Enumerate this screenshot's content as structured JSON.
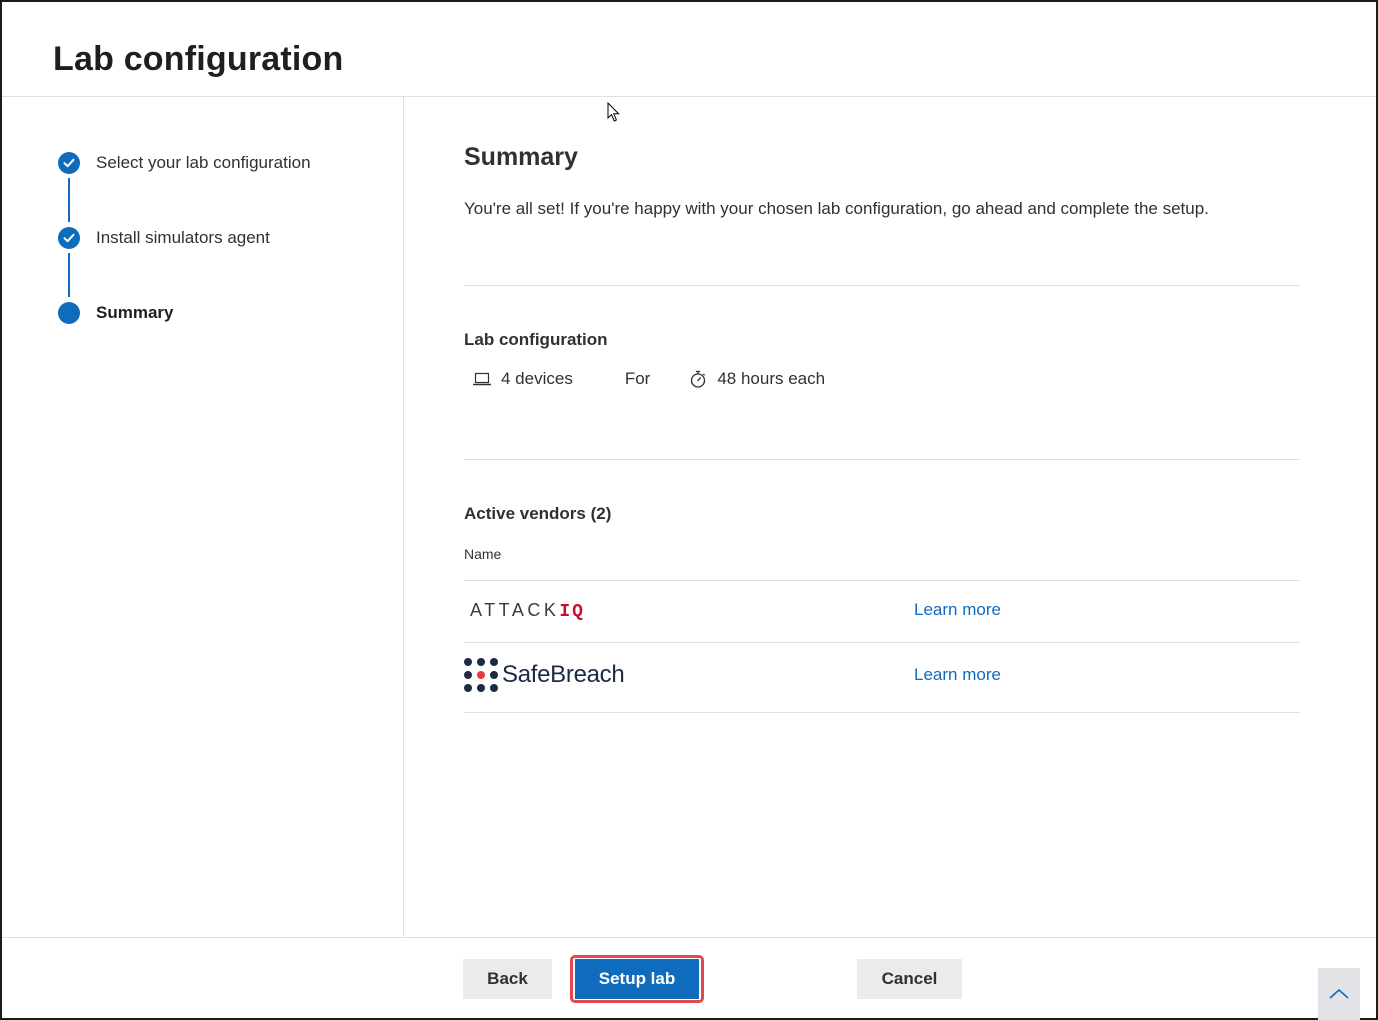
{
  "page": {
    "title": "Lab configuration"
  },
  "steps": [
    {
      "label": "Select your lab configuration",
      "state": "complete"
    },
    {
      "label": "Install simulators agent",
      "state": "complete"
    },
    {
      "label": "Summary",
      "state": "current"
    }
  ],
  "summary": {
    "title": "Summary",
    "description": "You're all set! If you're happy with your chosen lab configuration, go ahead and complete the setup."
  },
  "lab_config": {
    "title": "Lab configuration",
    "devices": "4 devices",
    "devices_icon": "laptop-icon",
    "for_text": "For",
    "duration": "48 hours each",
    "duration_icon": "stopwatch-icon"
  },
  "vendors": {
    "title": "Active vendors (2)",
    "column_name": "Name",
    "items": [
      {
        "logo_text_main": "ATTACK",
        "logo_text_accent": "IQ",
        "learn_more": "Learn more"
      },
      {
        "logo_text": "SafeBreach",
        "learn_more": "Learn more"
      }
    ]
  },
  "footer": {
    "back_label": "Back",
    "setup_label": "Setup lab",
    "cancel_label": "Cancel"
  },
  "colors": {
    "accent": "#0f6cbd",
    "highlight": "#e5474f",
    "attackiq_red": "#c8102e",
    "safebreach_navy": "#1c2a44"
  }
}
